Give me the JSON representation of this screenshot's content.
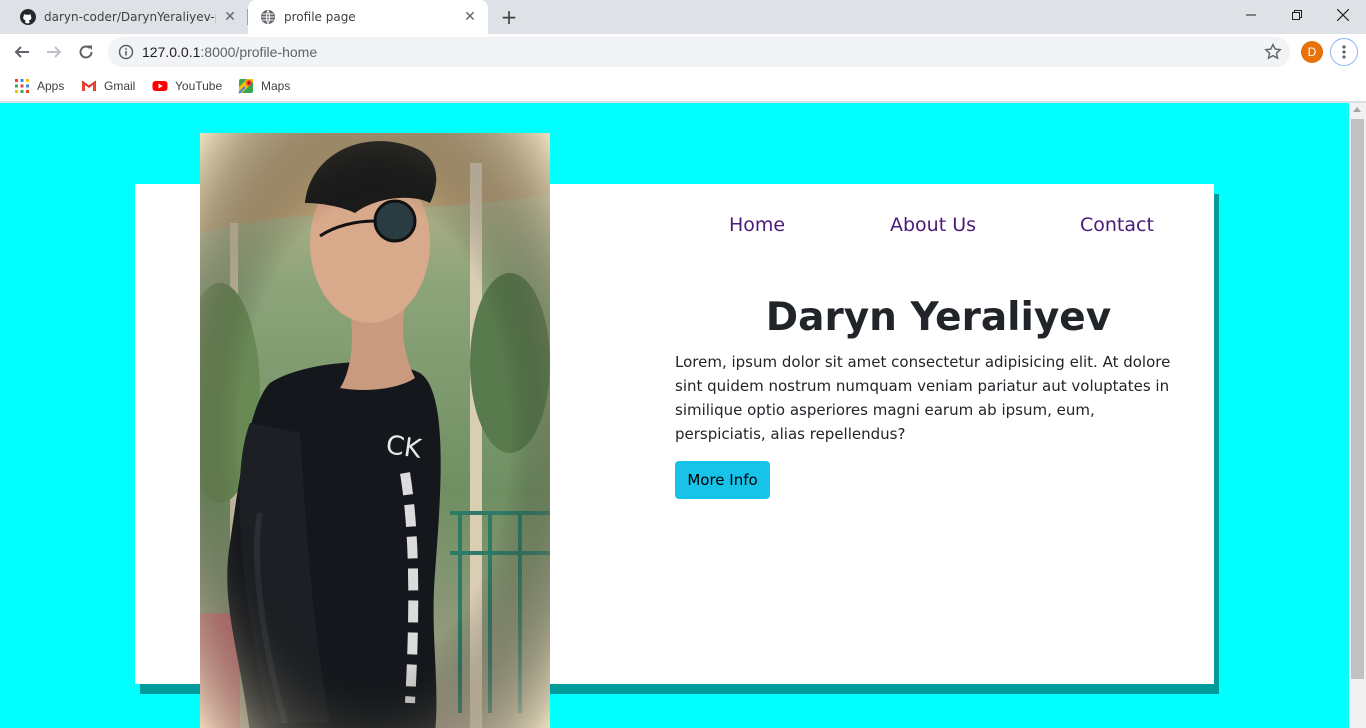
{
  "browser": {
    "tabs": [
      {
        "title": "daryn-coder/DarynYeraliyev-prof",
        "icon": "github-icon",
        "active": false
      },
      {
        "title": "profile page",
        "icon": "globe-icon",
        "active": true
      }
    ],
    "new_tab_label": "+",
    "address": {
      "host": "127.0.0.1",
      "path": ":8000/profile-home"
    },
    "profile_initial": "D",
    "bookmarks": [
      {
        "label": "Apps",
        "icon": "apps-grid-icon"
      },
      {
        "label": "Gmail",
        "icon": "gmail-icon"
      },
      {
        "label": "YouTube",
        "icon": "youtube-icon"
      },
      {
        "label": "Maps",
        "icon": "maps-icon"
      }
    ]
  },
  "page": {
    "background": "#00ffff",
    "nav": {
      "home": "Home",
      "about": "About Us",
      "contact": "Contact"
    },
    "name": "Daryn Yeraliyev",
    "bio": "Lorem, ipsum dolor sit amet consectetur adipisicing elit. At dolore sint quidem nostrum numquam veniam pariatur aut voluptates in similique optio asperiores magni earum ab ipsum, eum, perspiciatis, alias repellendus?",
    "more_button": "More Info",
    "colors": {
      "nav_link": "#4b1a78",
      "button": "#17c3e8",
      "card_shadow": "#009b9b"
    }
  }
}
